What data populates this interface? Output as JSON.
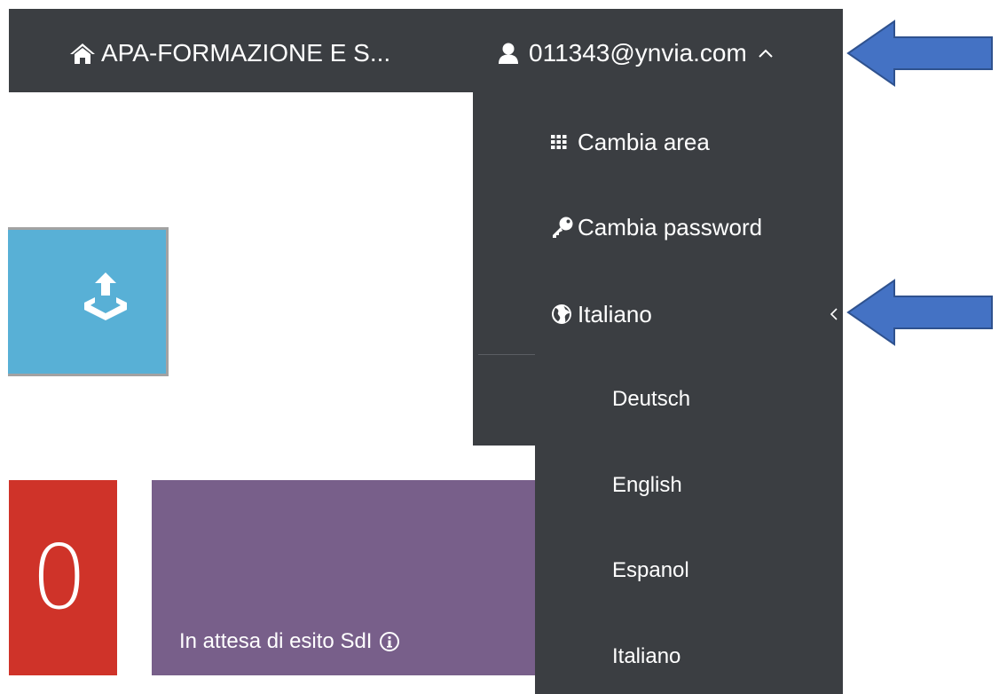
{
  "navbar": {
    "company_label": "APA-FORMAZIONE E S...",
    "user_label": "011343@ynvia.com"
  },
  "user_menu": {
    "items": [
      {
        "label": "Cambia area",
        "icon": "grid-icon"
      },
      {
        "label": "Cambia password",
        "icon": "key-icon"
      },
      {
        "label": "Italiano",
        "icon": "globe-icon"
      }
    ]
  },
  "language_submenu": {
    "items": [
      "Deutsch",
      "English",
      "Espanol",
      "Italiano"
    ]
  },
  "tiles": {
    "pending_count": "0",
    "pending_label": "In attesa di esito SdI"
  },
  "colors": {
    "navbar_bg": "#3b3e42",
    "upload_tile": "#58b0d6",
    "count_tile": "#cf3329",
    "pending_tile": "#785f8a",
    "annotation_arrow": "#4472c4"
  }
}
